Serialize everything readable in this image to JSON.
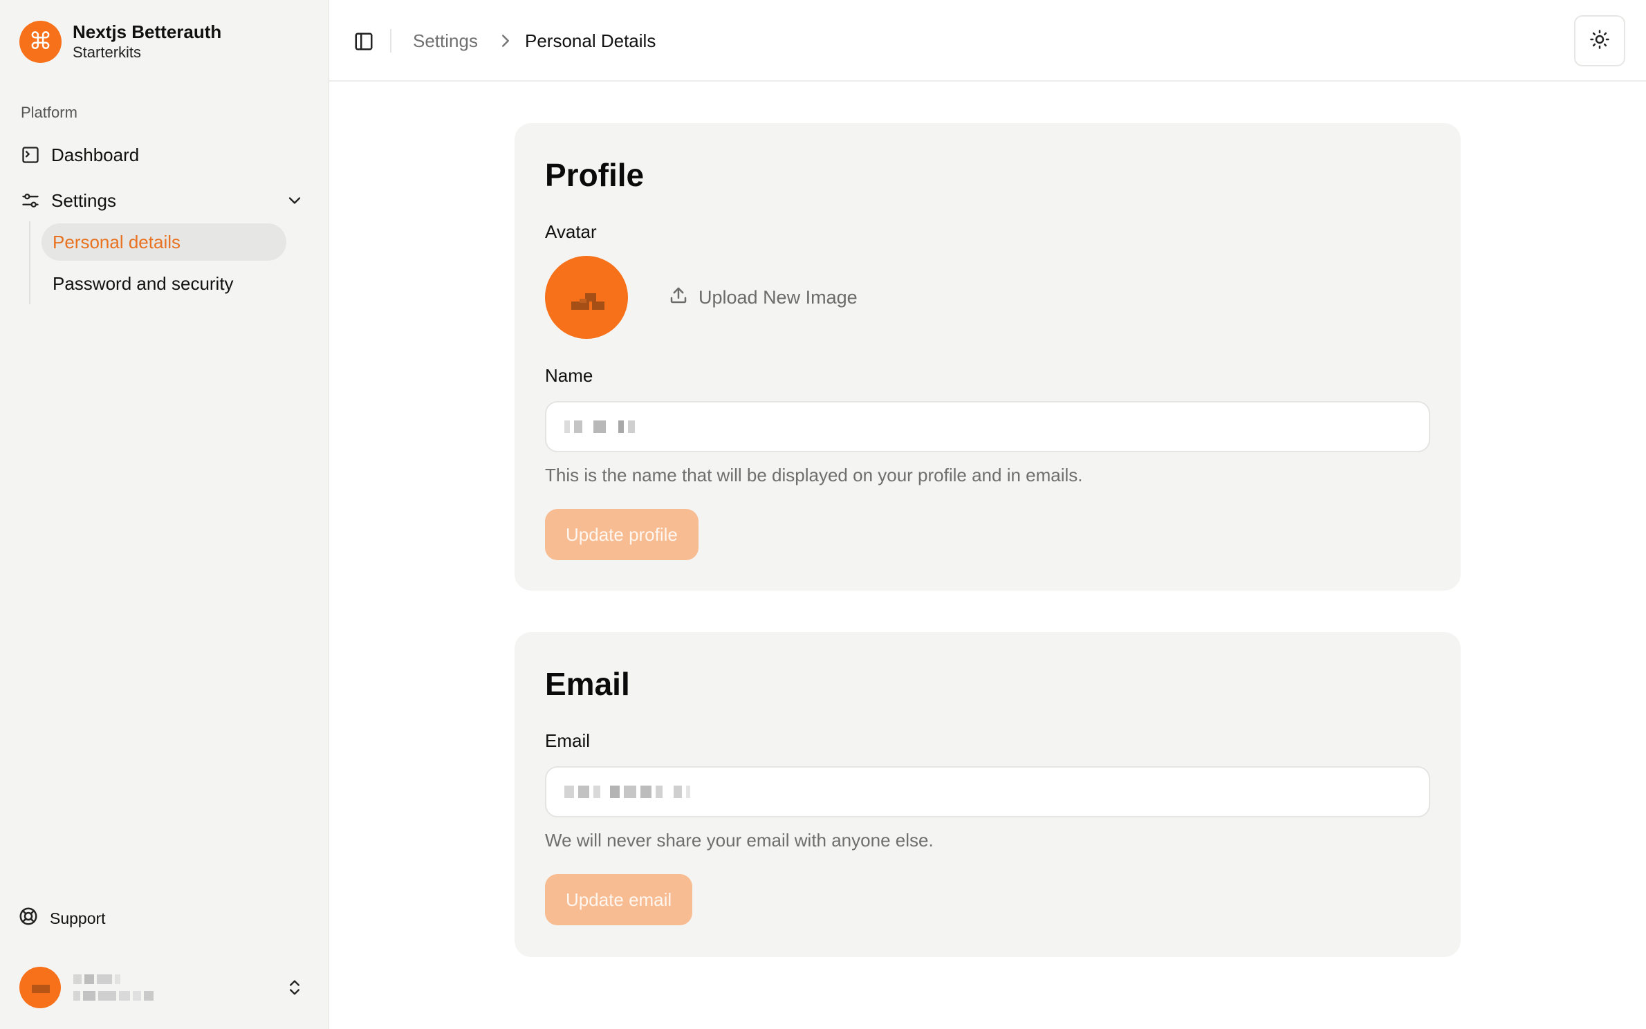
{
  "brand": {
    "title": "Nextjs Betterauth",
    "subtitle": "Starterkits",
    "logo_glyph": "⌘",
    "logo_icon": "command-icon"
  },
  "sidebar": {
    "group_label": "Platform",
    "items": [
      {
        "label": "Dashboard",
        "icon": "dashboard-icon"
      },
      {
        "label": "Settings",
        "icon": "settings-sliders-icon",
        "expanded": true
      }
    ],
    "sub_items": [
      {
        "label": "Personal details",
        "active": true
      },
      {
        "label": "Password and security",
        "active": false
      }
    ],
    "support_label": "Support",
    "support_icon": "life-buoy-icon",
    "user_switch_icon": "chevrons-up-down-icon"
  },
  "header": {
    "toggle_icon": "panel-left-icon",
    "breadcrumb": {
      "parent": "Settings",
      "separator_icon": "chevron-right-icon",
      "current": "Personal Details"
    },
    "theme_icon": "sun-icon"
  },
  "profile_card": {
    "title": "Profile",
    "avatar_label": "Avatar",
    "upload_label": "Upload New Image",
    "upload_icon": "upload-icon",
    "name_label": "Name",
    "name_helper": "This is the name that will be displayed on your profile and in emails.",
    "submit_label": "Update profile"
  },
  "email_card": {
    "title": "Email",
    "email_label": "Email",
    "email_helper": "We will never share your email with anyone else.",
    "submit_label": "Update email"
  },
  "colors": {
    "accent": "#f7711a",
    "active_nav_text": "#e8721f",
    "button_disabled_bg": "#f8bc92",
    "sidebar_bg": "#f4f4f3",
    "card_bg": "#f4f4f3"
  }
}
